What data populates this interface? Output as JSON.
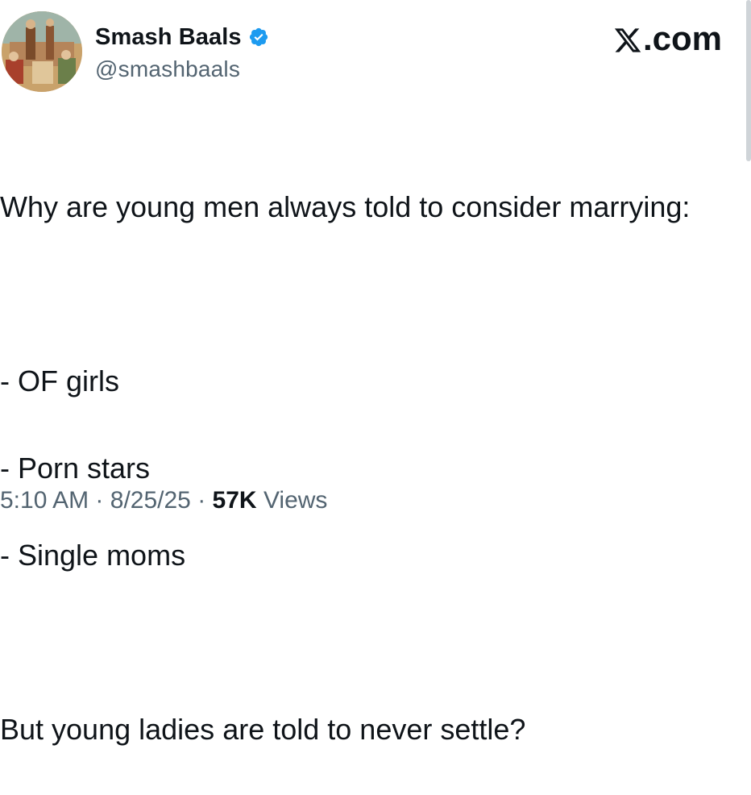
{
  "author": {
    "display_name": "Smash Baals",
    "handle": "@smashbaals",
    "verified_icon": "verified-badge-icon",
    "verified_color": "#1d9bf0"
  },
  "brand": {
    "suffix": ".com",
    "logo_icon": "x-logo-icon"
  },
  "tweet": {
    "lines": [
      "Why are young men always told to consider marrying:",
      "",
      "- OF girls",
      "- Porn stars",
      "- Single moms",
      "",
      "But young ladies are told to never settle?"
    ]
  },
  "meta": {
    "time": "5:10 AM",
    "separator": "·",
    "date": "8/25/25",
    "views_count": "57K",
    "views_label": "Views"
  }
}
